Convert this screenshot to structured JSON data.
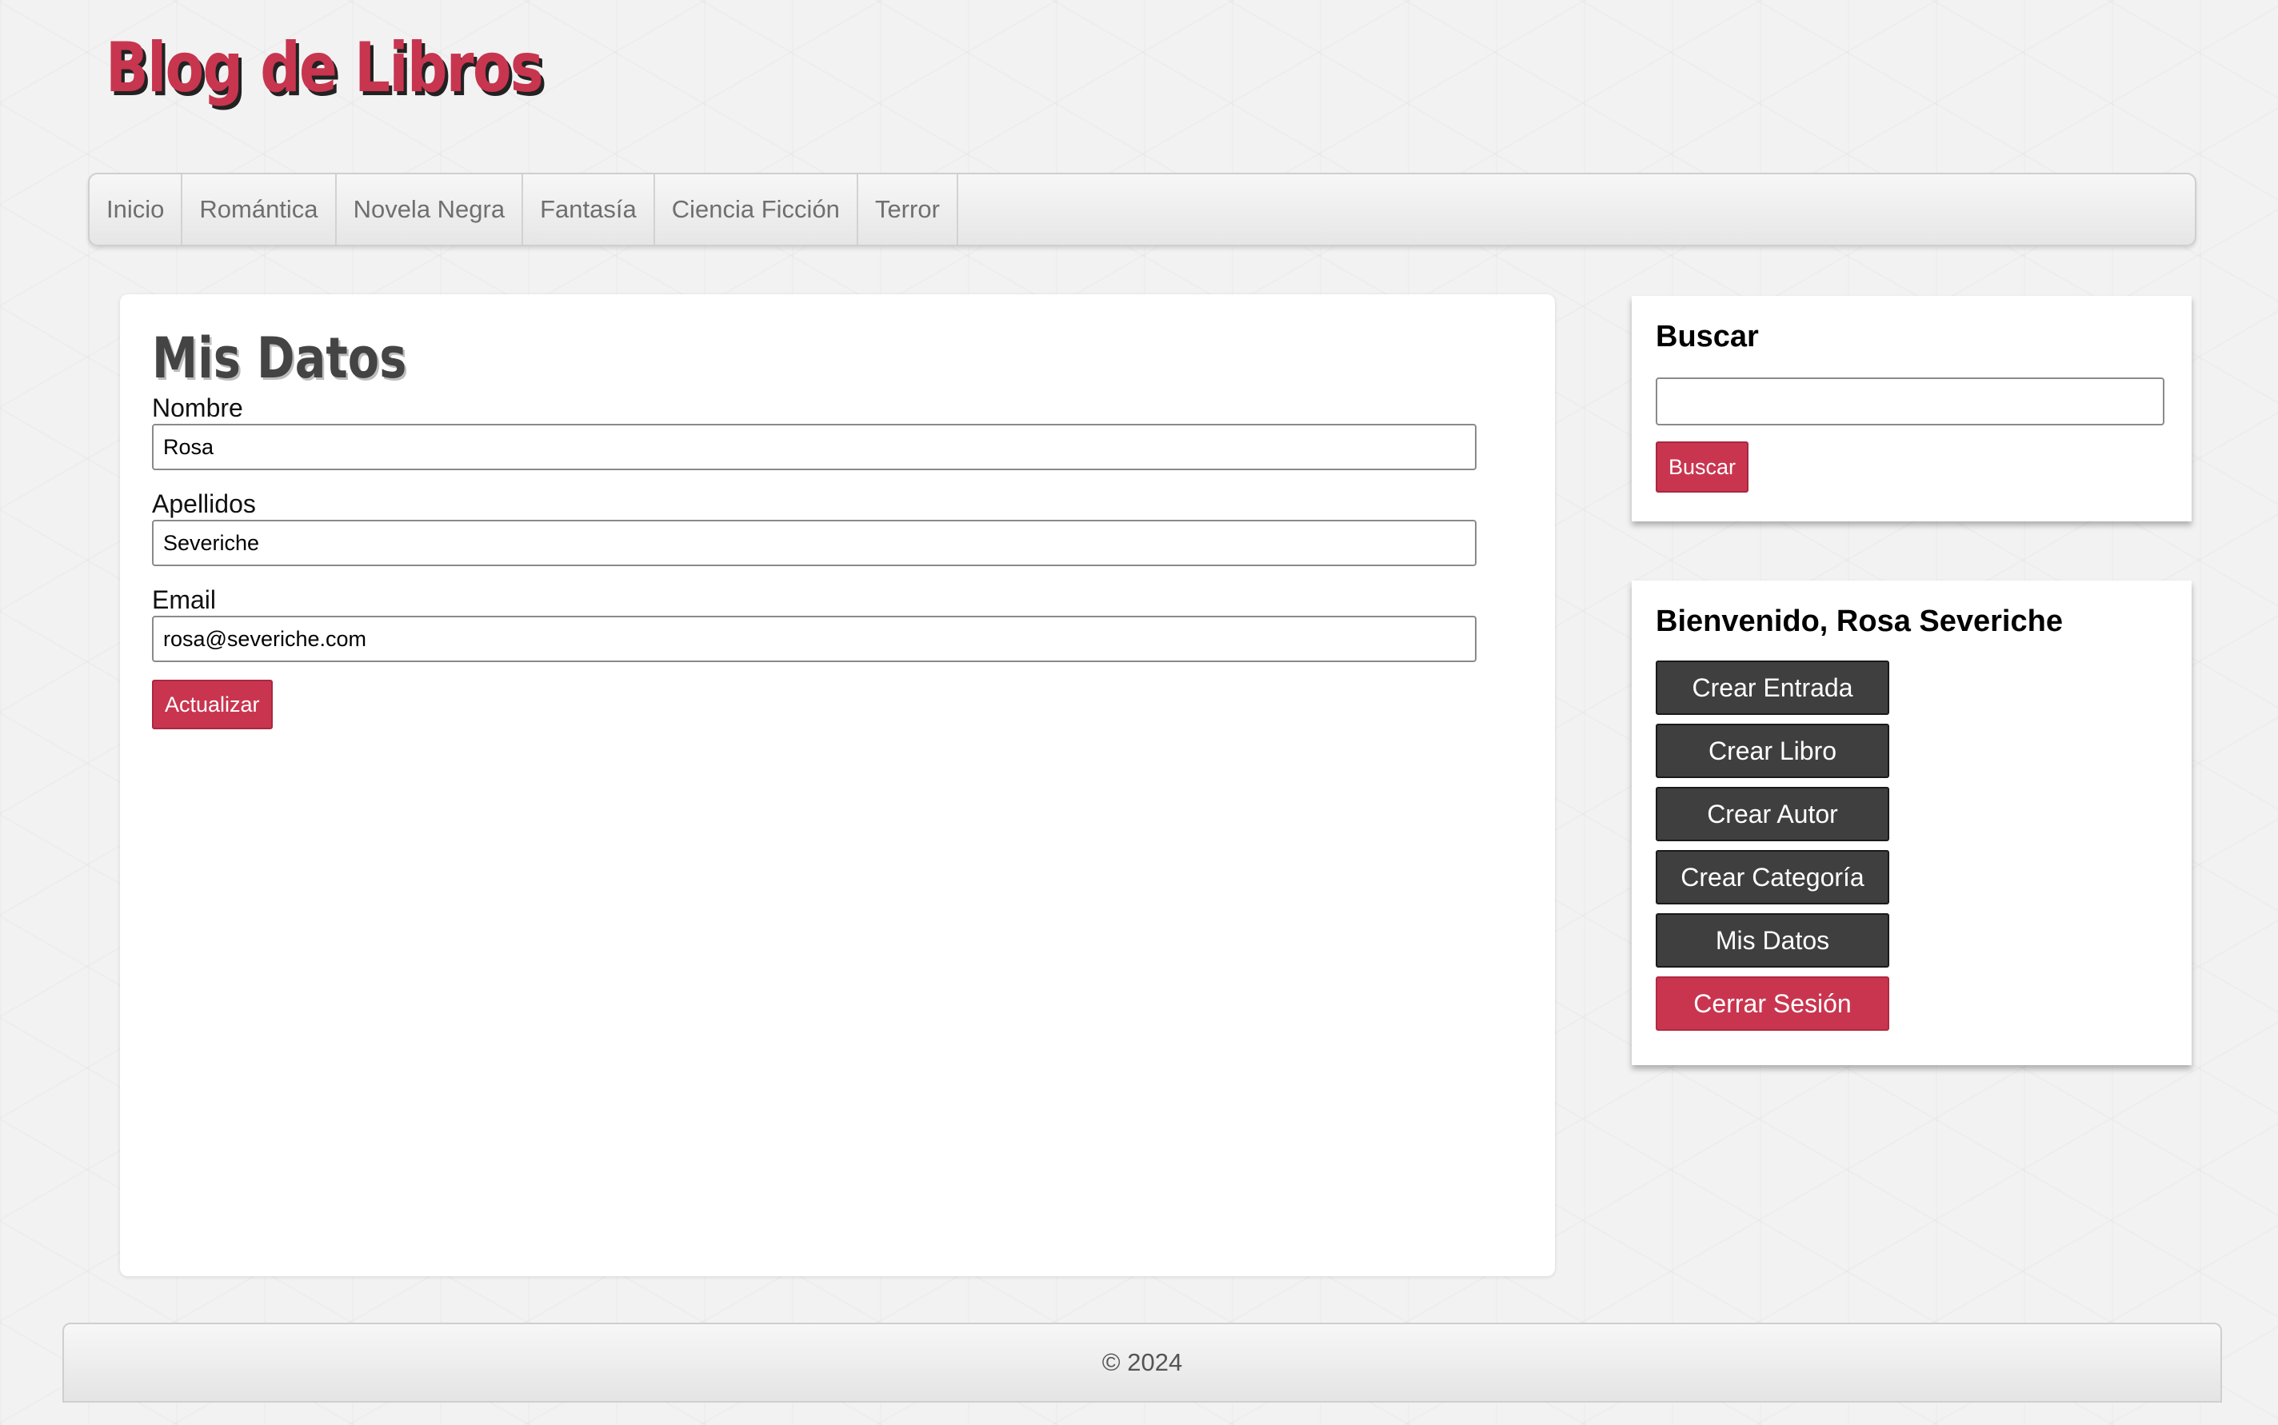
{
  "header": {
    "site_title": "Blog de Libros"
  },
  "nav": {
    "items": [
      {
        "label": "Inicio"
      },
      {
        "label": "Romántica"
      },
      {
        "label": "Novela Negra"
      },
      {
        "label": "Fantasía"
      },
      {
        "label": "Ciencia Ficción"
      },
      {
        "label": "Terror"
      }
    ]
  },
  "main": {
    "title": "Mis Datos",
    "form": {
      "nombre": {
        "label": "Nombre",
        "value": "Rosa"
      },
      "apellidos": {
        "label": "Apellidos",
        "value": "Severiche"
      },
      "email": {
        "label": "Email",
        "value": "rosa@severiche.com"
      },
      "submit_label": "Actualizar"
    }
  },
  "sidebar": {
    "search": {
      "title": "Buscar",
      "input_value": "",
      "button_label": "Buscar"
    },
    "welcome": {
      "title": "Bienvenido, Rosa Severiche",
      "actions": [
        {
          "label": "Crear Entrada"
        },
        {
          "label": "Crear Libro"
        },
        {
          "label": "Crear Autor"
        },
        {
          "label": "Crear Categoría"
        },
        {
          "label": "Mis Datos"
        },
        {
          "label": "Cerrar Sesión"
        }
      ]
    }
  },
  "footer": {
    "text": "© 2024"
  },
  "colors": {
    "accent": "#c9354f",
    "dark_button": "#3f3f3f",
    "background": "#f2f2f2"
  }
}
